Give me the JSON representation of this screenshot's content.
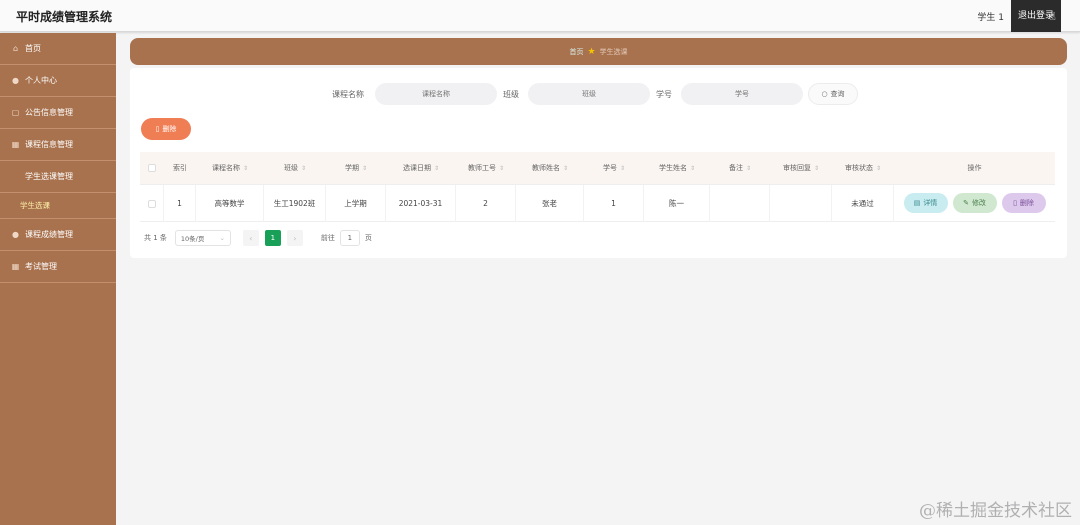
{
  "header": {
    "title": "平时成绩管理系统",
    "user": "学生 1",
    "logout": "退出登录"
  },
  "sidebar": {
    "items": [
      {
        "label": "首页",
        "icon": "home-icon"
      },
      {
        "label": "个人中心",
        "icon": "user-icon"
      },
      {
        "label": "公告信息管理",
        "icon": "notice-icon"
      },
      {
        "label": "课程信息管理",
        "icon": "book-icon"
      },
      {
        "label": "学生选课管理",
        "icon": ""
      },
      {
        "label": "学生选课",
        "icon": "",
        "sub": true
      },
      {
        "label": "课程成绩管理",
        "icon": "score-icon"
      },
      {
        "label": "考试管理",
        "icon": "exam-icon"
      }
    ]
  },
  "breadcrumb": {
    "home": "首页",
    "current": "学生选课"
  },
  "search": {
    "course_label": "课程名称",
    "course_placeholder": "课程名称",
    "class_label": "班级",
    "class_placeholder": "班级",
    "id_label": "学号",
    "id_placeholder": "学号",
    "button": "查询"
  },
  "actions": {
    "delete": "删除"
  },
  "table": {
    "columns": [
      "索引",
      "课程名称",
      "班级",
      "学期",
      "选课日期",
      "教师工号",
      "教师姓名",
      "学号",
      "学生姓名",
      "备注",
      "审核回复",
      "审核状态",
      "操作"
    ],
    "rows": [
      {
        "index": "1",
        "course": "高等数学",
        "class": "生工1902班",
        "term": "上学期",
        "date": "2021-03-31",
        "teacher_id": "2",
        "teacher_name": "张老",
        "student_id": "1",
        "student_name": "陈一",
        "note": "",
        "reply": "",
        "status": "未通过"
      }
    ],
    "row_ops": {
      "detail": "详情",
      "edit": "修改",
      "delete": "删除"
    }
  },
  "pager": {
    "total": "共 1 条",
    "page_size": "10条/页",
    "current": "1",
    "goto": "前往",
    "goto_value": "1",
    "page_unit": "页"
  },
  "watermark": "@稀土掘金技术社区",
  "colors": {
    "sidebar": "#a8724e",
    "delete_button": "#f07e54",
    "active_page": "#18a058"
  }
}
